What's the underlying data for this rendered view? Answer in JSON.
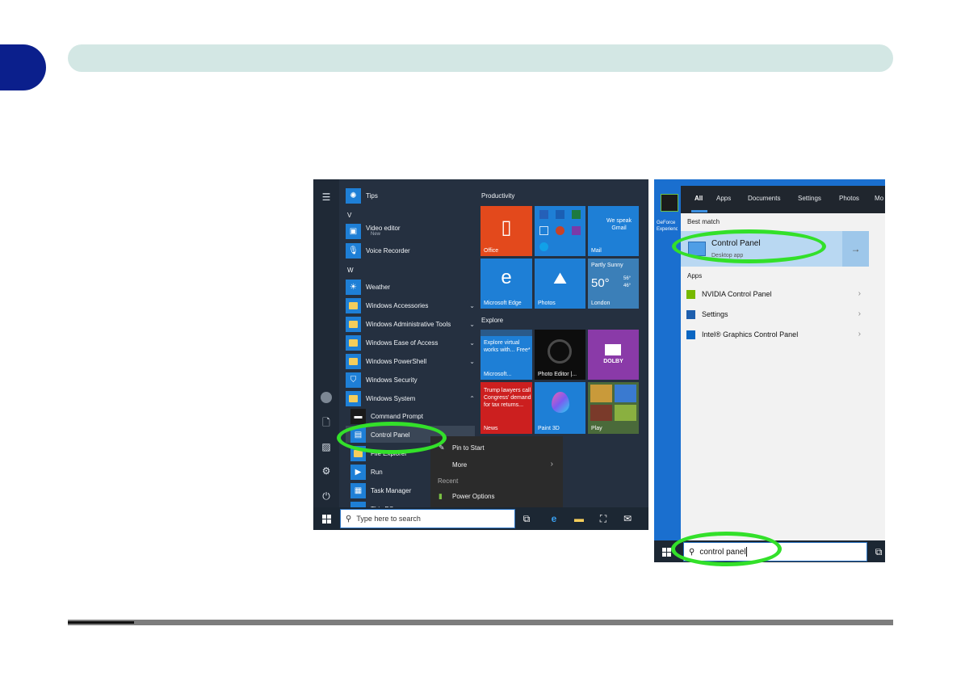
{
  "start_menu": {
    "apps": [
      {
        "name": "tips",
        "label": "Tips",
        "icon": "lightbulb-icon"
      },
      {
        "name": "letter-v",
        "label": "V"
      },
      {
        "name": "video-editor",
        "label": "Video editor",
        "sub": "New",
        "icon": "photo-icon"
      },
      {
        "name": "voice-recorder",
        "label": "Voice Recorder",
        "icon": "microphone-icon"
      },
      {
        "name": "letter-w",
        "label": "W"
      },
      {
        "name": "weather",
        "label": "Weather",
        "icon": "sun-icon"
      },
      {
        "name": "windows-accessories",
        "label": "Windows Accessories",
        "icon": "folder-icon"
      },
      {
        "name": "windows-admin-tools",
        "label": "Windows Administrative Tools",
        "icon": "folder-icon"
      },
      {
        "name": "windows-ease-of-access",
        "label": "Windows Ease of Access",
        "icon": "folder-icon"
      },
      {
        "name": "windows-powershell",
        "label": "Windows PowerShell",
        "icon": "folder-icon"
      },
      {
        "name": "windows-security",
        "label": "Windows Security",
        "icon": "shield-icon"
      },
      {
        "name": "windows-system",
        "label": "Windows System",
        "icon": "folder-icon"
      },
      {
        "name": "command-prompt",
        "label": "Command Prompt",
        "icon": "terminal-icon"
      },
      {
        "name": "control-panel",
        "label": "Control Panel",
        "icon": "control-panel-icon"
      },
      {
        "name": "file-explorer",
        "label": "File Explorer",
        "icon": "folder-icon"
      },
      {
        "name": "run",
        "label": "Run",
        "icon": "run-icon"
      },
      {
        "name": "task-manager",
        "label": "Task Manager",
        "icon": "task-manager-icon"
      },
      {
        "name": "this-pc",
        "label": "This PC",
        "icon": "computer-icon"
      }
    ],
    "groups": {
      "productivity": "Productivity",
      "explore": "Explore"
    },
    "tiles": {
      "office": "Office",
      "mail_text": "We speak Gmail",
      "mail": "Mail",
      "edge": "Microsoft Edge",
      "photos": "Photos",
      "weather_cond": "Partly Sunny",
      "weather_temp": "50°",
      "weather_hi": "56°",
      "weather_lo": "46°",
      "weather_city": "London",
      "store_text": "Explore virtual works with... Free*",
      "store": "Microsoft...",
      "photo_editor": "Photo Editor |...",
      "dolby": "DOLBY",
      "news_text": "Trump lawyers call Congress' demand for tax returns...",
      "news": "News",
      "paint3d": "Paint 3D",
      "play": "Play"
    },
    "context_menu": {
      "pin": "Pin to Start",
      "more": "More",
      "recent": "Recent",
      "power": "Power Options"
    },
    "search_placeholder": "Type here to search"
  },
  "search_panel": {
    "desktop_label": "GeForce Experience",
    "tabs": [
      "All",
      "Apps",
      "Documents",
      "Settings",
      "Photos",
      "Mo"
    ],
    "best_match_label": "Best match",
    "best_match_title": "Control Panel",
    "best_match_sub": "Desktop app",
    "apps_label": "Apps",
    "results": [
      {
        "label": "NVIDIA Control Panel",
        "color": "#76b900"
      },
      {
        "label": "Settings",
        "color": "#1e5fae"
      },
      {
        "label": "Intel® Graphics Control Panel",
        "color": "#0a66c2"
      }
    ],
    "query": "control panel"
  },
  "colors": {
    "highlight": "#33e02a",
    "chapter_tab": "#0b1f8c",
    "header_bar": "#d3e7e4"
  }
}
